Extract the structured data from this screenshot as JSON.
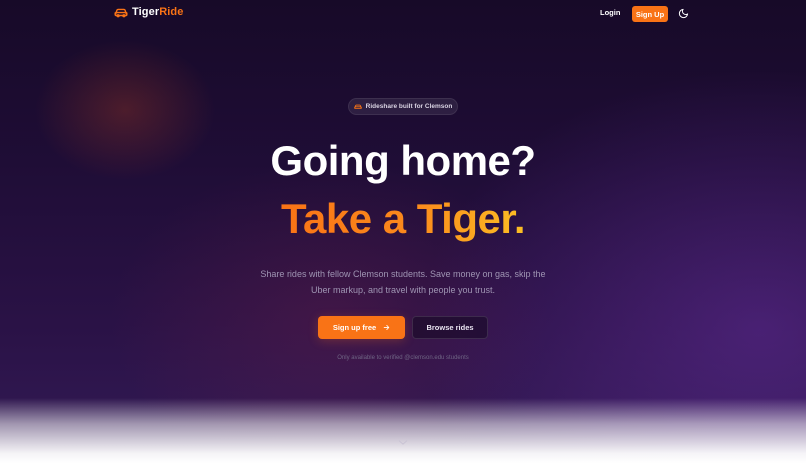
{
  "brand": {
    "name_part1": "Tiger",
    "name_part2": "Ride",
    "icon": "car-icon",
    "accent_color": "#f97316"
  },
  "nav": {
    "login_label": "Login",
    "signup_label": "Sign Up",
    "theme_icon": "moon-icon"
  },
  "hero": {
    "badge_icon": "car-icon",
    "badge_text": "Rideshare built for Clemson",
    "headline_line1": "Going home?",
    "headline_line2": "Take a Tiger.",
    "subtitle": "Share rides with fellow Clemson students. Save money on gas, skip the Uber markup, and travel with people you trust.",
    "primary_cta_label": "Sign up free",
    "primary_cta_icon": "arrow-right-icon",
    "secondary_cta_label": "Browse rides",
    "note": "Only available to verified @clemson.edu students",
    "scroll_icon": "chevron-down-icon"
  }
}
